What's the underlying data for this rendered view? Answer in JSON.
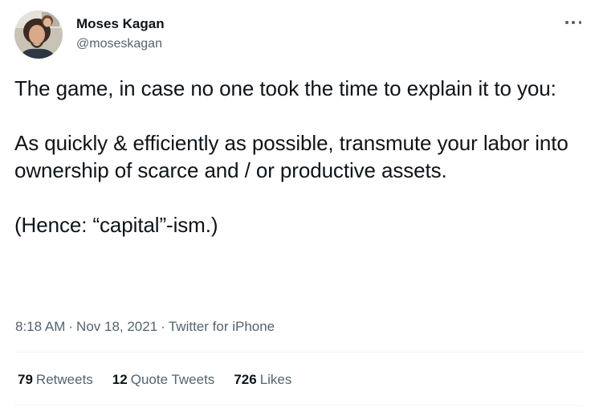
{
  "author": {
    "name": "Moses Kagan",
    "handle": "@moseskagan"
  },
  "menu": {
    "icon": "more-horizontal-icon"
  },
  "tweet": {
    "paragraph_1": "The game, in case no one took the time to explain it to you:",
    "paragraph_2": "As quickly & efficiently as possible, transmute your labor into ownership of scarce and / or productive assets.",
    "paragraph_3": "(Hence: “capital”-ism.)"
  },
  "meta": {
    "time": "8:18 AM",
    "separator": "·",
    "date": "Nov 18, 2021",
    "source": "Twitter for iPhone"
  },
  "stats": {
    "retweets_count": "79",
    "retweets_label": "Retweets",
    "quote_tweets_count": "12",
    "quote_tweets_label": "Quote Tweets",
    "likes_count": "726",
    "likes_label": "Likes"
  },
  "colors": {
    "text_primary": "#0f1419",
    "text_secondary": "#536471",
    "divider": "#eff3f4"
  }
}
